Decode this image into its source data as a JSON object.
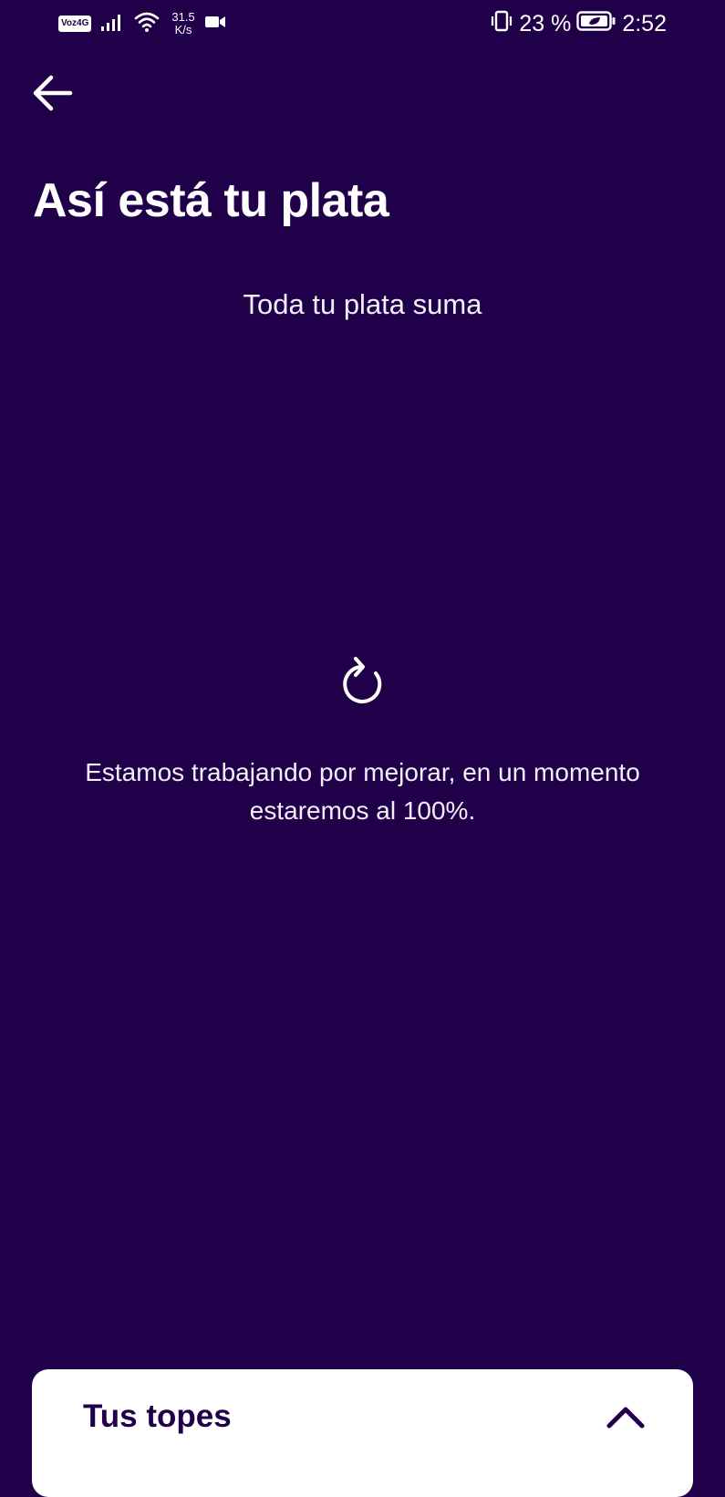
{
  "status_bar": {
    "network_badge": "Voz4G",
    "speed_value": "31.5",
    "speed_unit": "K/s",
    "battery_percent": "23 %",
    "time": "2:52",
    "icons": [
      "signal-icon",
      "wifi-icon",
      "video-record-icon",
      "vibrate-icon",
      "battery-saver-icon"
    ]
  },
  "header": {
    "back_icon": "arrow-left-icon",
    "title": "Así está tu plata"
  },
  "main": {
    "subtitle": "Toda tu plata suma",
    "refresh_icon": "refresh-icon",
    "message": "Estamos trabajando por mejorar, en un momento estaremos al 100%."
  },
  "bottom_card": {
    "title": "Tus topes",
    "toggle_icon": "chevron-up-icon"
  },
  "colors": {
    "background": "#200048",
    "text": "#ffffff",
    "card_background": "#ffffff",
    "card_text": "#200048"
  }
}
